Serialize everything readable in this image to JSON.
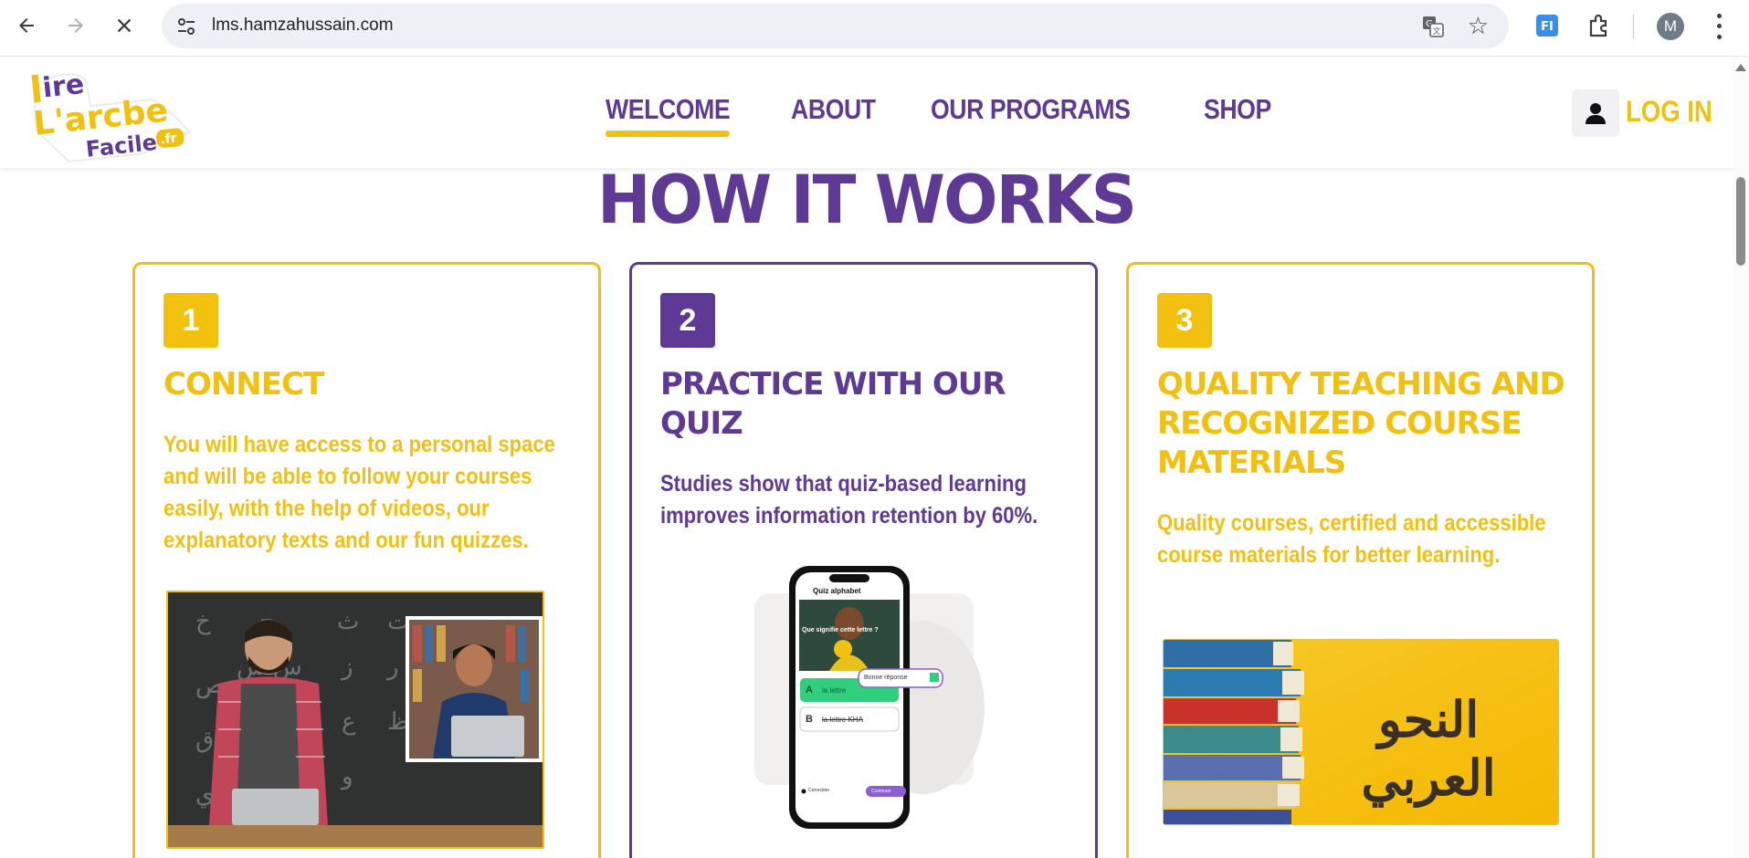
{
  "browser": {
    "url": "lms.hamzahussain.com",
    "profile_initial": "M",
    "extension_label": "FI"
  },
  "site": {
    "logo_text": [
      "lire",
      "L'arabe",
      "Facile",
      ".fr"
    ],
    "nav": [
      {
        "label": "WELCOME",
        "active": true
      },
      {
        "label": "ABOUT",
        "active": false
      },
      {
        "label": "OUR PROGRAMS",
        "active": false
      },
      {
        "label": "SHOP",
        "active": false
      }
    ],
    "login_label": "LOG IN",
    "colors": {
      "purple": "#5e3a94",
      "yellow": "#f2c00f"
    }
  },
  "section": {
    "title": "HOW IT WORKS",
    "cards": [
      {
        "number": "1",
        "title": "CONNECT",
        "description": "You will have access to a personal space and will be able to follow your courses easily, with the help of videos, our explanatory texts and our fun quizzes.",
        "image": "teacher-and-student-photo"
      },
      {
        "number": "2",
        "title": "PRACTICE WITH OUR QUIZ",
        "description": "Studies show that quiz-based learning improves information retention by 60%.",
        "image": "phone-quiz-mockup",
        "quiz": {
          "header": "Quiz alphabet",
          "question": "Que signifie cette lettre ?",
          "feedback": "Bonne réponse",
          "option_a_letter": "A",
          "option_a": "la lettre",
          "option_b_letter": "B",
          "option_b": "la lettre KHA",
          "footer_left": "Correction",
          "footer_button": "Continuer"
        }
      },
      {
        "number": "3",
        "title": "QUALITY TEACHING AND RECOGNIZED COURSE MATERIALS",
        "description": "Quality courses, certified and accessible course materials for better learning.",
        "image": "books-and-arabic-calligraphy",
        "calligraphy": "النحو العربي"
      }
    ]
  }
}
